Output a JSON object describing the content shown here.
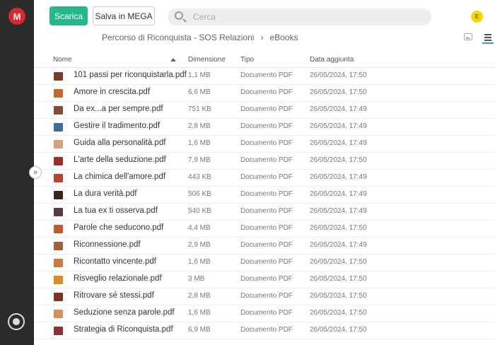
{
  "sidebar": {
    "logo": "M",
    "collapse_glyph": "»"
  },
  "toolbar": {
    "download_label": "Scarica",
    "save_label": "Salva in MEGA"
  },
  "search": {
    "placeholder": "Cerca",
    "value": ""
  },
  "avatar": {
    "initial": "E"
  },
  "breadcrumb": {
    "folder": "Percorso di Riconquista - SOS Relazioni",
    "separator": "›",
    "current": "eBooks"
  },
  "table": {
    "headers": {
      "name": "Nome",
      "size": "Dimensione",
      "type": "Tipo",
      "date": "Data aggiunta"
    },
    "rows": [
      {
        "name": "101 passi per riconquistarla.pdf",
        "size": "1,1 MB",
        "type": "Documento PDF",
        "date": "26/05/2024, 17:50",
        "thumb": "#7a3b2a"
      },
      {
        "name": "Amore in crescita.pdf",
        "size": "6,6 MB",
        "type": "Documento PDF",
        "date": "26/05/2024, 17:50",
        "thumb": "#c4682e"
      },
      {
        "name": "Da ex...a per sempre.pdf",
        "size": "751 KB",
        "type": "Documento PDF",
        "date": "26/05/2024, 17:49",
        "thumb": "#8a4a3a"
      },
      {
        "name": "Gestire il tradimento.pdf",
        "size": "2,8 MB",
        "type": "Documento PDF",
        "date": "26/05/2024, 17:49",
        "thumb": "#3f6c9a"
      },
      {
        "name": "Guida alla personalità.pdf",
        "size": "1,6 MB",
        "type": "Documento PDF",
        "date": "26/05/2024, 17:49",
        "thumb": "#d2a27a"
      },
      {
        "name": "L'arte della seduzione.pdf",
        "size": "7,9 MB",
        "type": "Documento PDF",
        "date": "26/05/2024, 17:50",
        "thumb": "#9c2f24"
      },
      {
        "name": "La chimica dell'amore.pdf",
        "size": "443 KB",
        "type": "Documento PDF",
        "date": "26/05/2024, 17:49",
        "thumb": "#b2452c"
      },
      {
        "name": "La dura verità.pdf",
        "size": "506 KB",
        "type": "Documento PDF",
        "date": "26/05/2024, 17:49",
        "thumb": "#3a2520"
      },
      {
        "name": "La tua ex ti osserva.pdf",
        "size": "540 KB",
        "type": "Documento PDF",
        "date": "26/05/2024, 17:49",
        "thumb": "#5a3a44"
      },
      {
        "name": "Parole che seducono.pdf",
        "size": "4,4 MB",
        "type": "Documento PDF",
        "date": "26/05/2024, 17:50",
        "thumb": "#c2582e"
      },
      {
        "name": "Riconnessione.pdf",
        "size": "2,9 MB",
        "type": "Documento PDF",
        "date": "26/05/2024, 17:49",
        "thumb": "#a0603c"
      },
      {
        "name": "Ricontatto vincente.pdf",
        "size": "1,6 MB",
        "type": "Documento PDF",
        "date": "26/05/2024, 17:50",
        "thumb": "#c97a3c"
      },
      {
        "name": "Risveglio relazionale.pdf",
        "size": "3 MB",
        "type": "Documento PDF",
        "date": "26/05/2024, 17:50",
        "thumb": "#d98a2a"
      },
      {
        "name": "Ritrovare sé stessi.pdf",
        "size": "2,8 MB",
        "type": "Documento PDF",
        "date": "26/05/2024, 17:50",
        "thumb": "#7c3524"
      },
      {
        "name": "Seduzione senza parole.pdf",
        "size": "1,6 MB",
        "type": "Documento PDF",
        "date": "26/05/2024, 17:50",
        "thumb": "#d4905a"
      },
      {
        "name": "Strategia di Riconquista.pdf",
        "size": "6,9 MB",
        "type": "Documento PDF",
        "date": "26/05/2024, 17:50",
        "thumb": "#8a3030"
      }
    ]
  }
}
